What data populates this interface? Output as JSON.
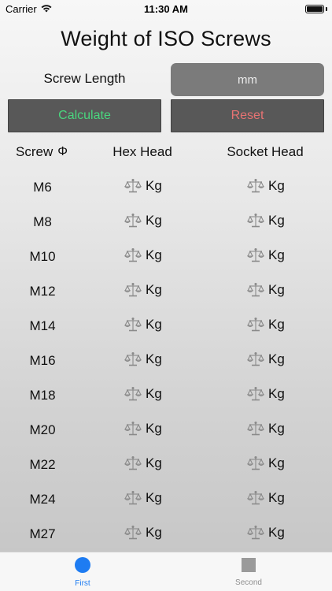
{
  "status_bar": {
    "carrier": "Carrier",
    "time": "11:30 AM"
  },
  "title": "Weight of ISO Screws",
  "length": {
    "label": "Screw Length",
    "placeholder": "mm"
  },
  "buttons": {
    "calculate": "Calculate",
    "reset": "Reset"
  },
  "colors": {
    "calculate_text": "#49d67e",
    "reset_text": "#e87373",
    "tab_active": "#1e7cf2"
  },
  "table": {
    "headers": {
      "screw": "Screw",
      "screw_icon": "Φ",
      "hex": "Hex Head",
      "socket": "Socket Head"
    },
    "unit": "Kg",
    "rows": [
      "M6",
      "M8",
      "M10",
      "M12",
      "M14",
      "M16",
      "M18",
      "M20",
      "M22",
      "M24",
      "M27"
    ]
  },
  "tabs": {
    "first": "First",
    "second": "Second"
  }
}
